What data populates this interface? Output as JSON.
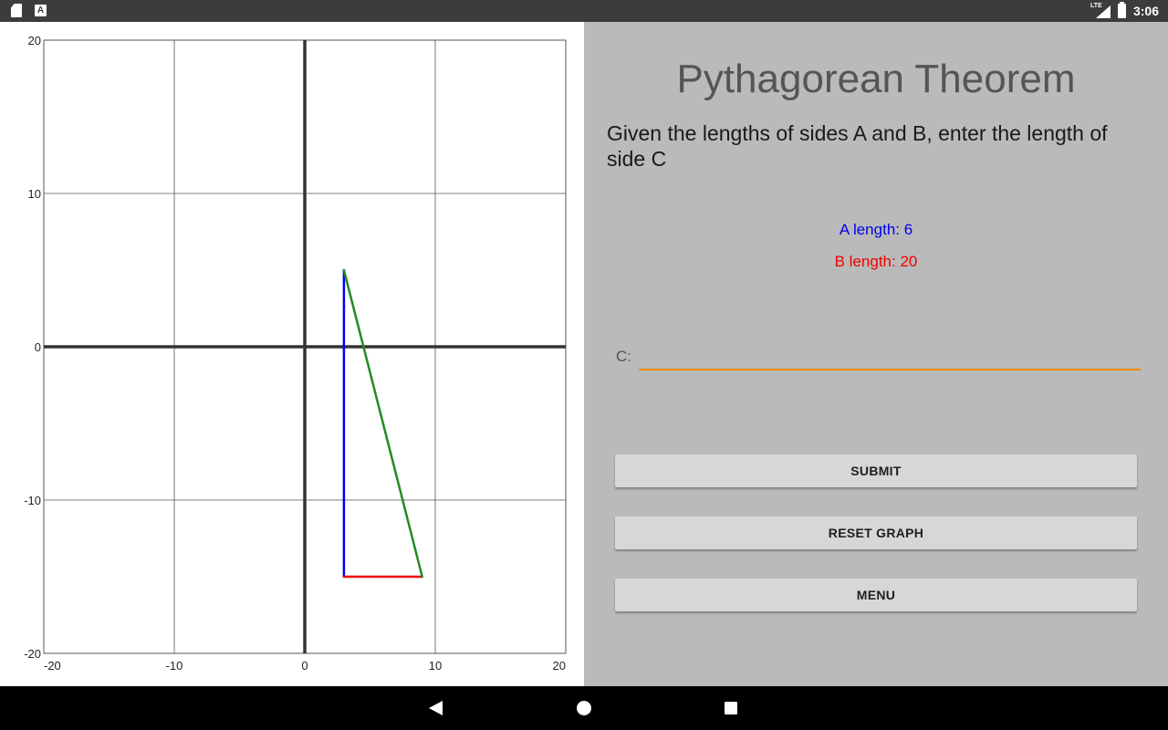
{
  "status_bar": {
    "time": "3:06",
    "network": "LTE",
    "icons": [
      "sd-card-icon",
      "text-a-icon",
      "lte-signal-icon",
      "battery-charging-icon"
    ]
  },
  "app": {
    "title": "Pythagorean Theorem",
    "instructions": "Given the lengths of sides A and B, enter the length of side C",
    "a_length_label": "A length: 6",
    "b_length_label": "B length: 20",
    "c_label": "C:",
    "c_value": "",
    "submit_label": "SUBMIT",
    "reset_label": "RESET GRAPH",
    "menu_label": "MENU",
    "colors": {
      "side_a": "#0000ee",
      "side_b": "#ee0000",
      "side_c": "#228b22",
      "input_underline": "#f08c00",
      "panel_background": "#bababa"
    }
  },
  "chart_data": {
    "type": "line",
    "xlim": [
      -20,
      20
    ],
    "ylim": [
      -20,
      20
    ],
    "x_ticks": [
      -20,
      -10,
      0,
      10,
      20
    ],
    "y_ticks": [
      -20,
      -10,
      0,
      10,
      20
    ],
    "x_tick_labels": [
      "-20",
      "-10",
      "0",
      "10",
      "20"
    ],
    "y_tick_labels": [
      "-20",
      "-10",
      "0",
      "10",
      "20"
    ],
    "grid": true,
    "series": [
      {
        "color": "#0000ee",
        "points": [
          [
            3,
            5
          ],
          [
            3,
            -15
          ]
        ]
      },
      {
        "color": "#ee0000",
        "points": [
          [
            3,
            -15
          ],
          [
            9,
            -15
          ]
        ]
      },
      {
        "color": "#228b22",
        "points": [
          [
            3,
            5
          ],
          [
            9,
            -15
          ]
        ]
      }
    ]
  },
  "nav_bar": {
    "icons": [
      "back-icon",
      "home-icon",
      "recent-apps-icon"
    ]
  }
}
